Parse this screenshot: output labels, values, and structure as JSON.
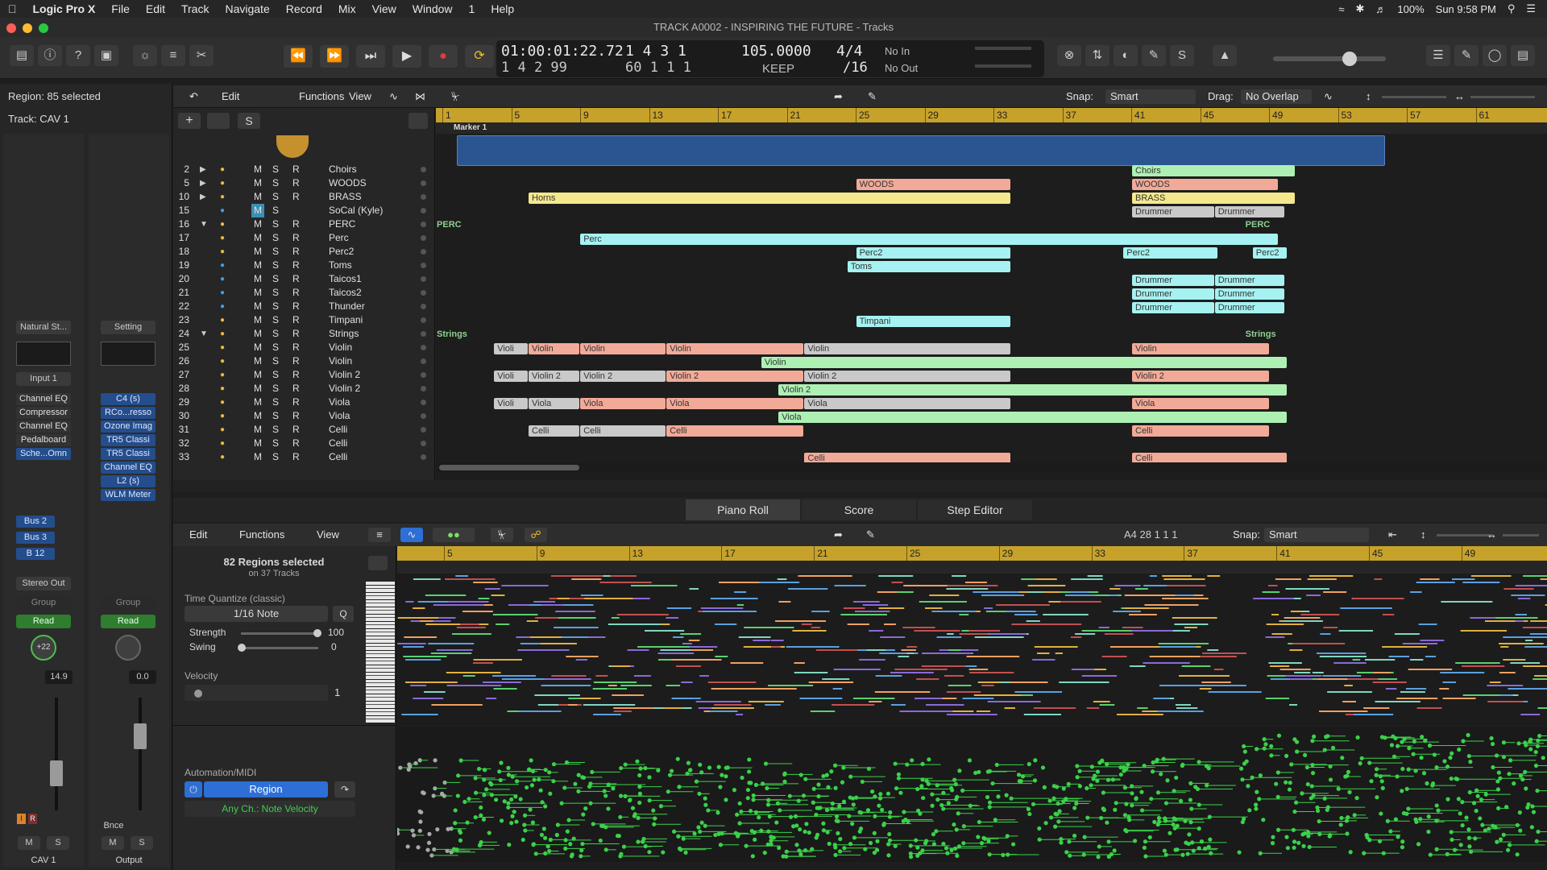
{
  "menubar": {
    "app": "Logic Pro X",
    "items": [
      "File",
      "Edit",
      "Track",
      "Navigate",
      "Record",
      "Mix",
      "View",
      "Window",
      "1",
      "Help"
    ],
    "battery": "100%",
    "clock": "Sun 9:58 PM"
  },
  "window": {
    "title": "TRACK A0002 - INSPIRING THE FUTURE - Tracks"
  },
  "lcd": {
    "time": "01:00:01:22.72",
    "time_sub": "1  4  2  99",
    "bars": "1  4  3     1",
    "bars_sub": "60  1  1     1",
    "tempo": "105.0000",
    "tempo_sub": "KEEP",
    "sig": "4/4",
    "sig_sub": "/16",
    "in": "No In",
    "out": "No Out"
  },
  "inspector": {
    "region": "Region: 85 selected",
    "track": "Track: CAV 1",
    "preset": "Natural St...",
    "setting": "Setting",
    "input": "Input 1",
    "plugins_left": [
      "Channel EQ",
      "Compressor",
      "Channel EQ",
      "Pedalboard",
      "Sche...Omn"
    ],
    "plugins_right": [
      "C4 (s)",
      "RCo...resso",
      "Ozone Imag",
      "TR5 Classi",
      "TR5 Classi",
      "Channel EQ",
      "L2 (s)",
      "WLM Meter"
    ],
    "sends": [
      "Bus 2",
      "Bus 3",
      "B 12"
    ],
    "stereo_out": "Stereo Out",
    "group": "Group",
    "read": "Read",
    "pan_left": "+22",
    "vol_left": "14.9",
    "vol_right": "0.0",
    "bnce": "Bnce",
    "m": "M",
    "s": "S",
    "name_left": "CAV 1",
    "name_right": "Output"
  },
  "tracks_toolbar": {
    "edit": "Edit",
    "functions": "Functions",
    "view": "View",
    "snap_label": "Snap:",
    "snap": "Smart",
    "drag_label": "Drag:",
    "drag": "No Overlap"
  },
  "ruler": [
    "1",
    "5",
    "9",
    "13",
    "17",
    "21",
    "25",
    "29",
    "33",
    "37",
    "41",
    "45",
    "49",
    "53",
    "57",
    "61"
  ],
  "marker": "Marker 1",
  "track_rows": [
    {
      "num": "2",
      "name": "Choirs"
    },
    {
      "num": "5",
      "name": "WOODS"
    },
    {
      "num": "10",
      "name": "BRASS"
    },
    {
      "num": "15",
      "name": "SoCal (Kyle)"
    },
    {
      "num": "16",
      "name": "PERC"
    },
    {
      "num": "17",
      "name": "Perc"
    },
    {
      "num": "18",
      "name": "Perc2"
    },
    {
      "num": "19",
      "name": "Toms"
    },
    {
      "num": "20",
      "name": "Taicos1"
    },
    {
      "num": "21",
      "name": "Taicos2"
    },
    {
      "num": "22",
      "name": "Thunder"
    },
    {
      "num": "23",
      "name": "Timpani"
    },
    {
      "num": "24",
      "name": "Strings"
    },
    {
      "num": "25",
      "name": "Violin"
    },
    {
      "num": "26",
      "name": "Violin"
    },
    {
      "num": "27",
      "name": "Violin 2"
    },
    {
      "num": "28",
      "name": "Violin 2"
    },
    {
      "num": "29",
      "name": "Viola"
    },
    {
      "num": "30",
      "name": "Viola"
    },
    {
      "num": "31",
      "name": "Celli"
    },
    {
      "num": "32",
      "name": "Celli"
    },
    {
      "num": "33",
      "name": "Celli"
    }
  ],
  "track_ms": {
    "m": "M",
    "s": "S",
    "r": "R"
  },
  "region_labels": {
    "choirs": "Choirs",
    "woods": "WOODS",
    "brass": "BRASS",
    "horns": "Horns",
    "drummer": "Drummer",
    "perc_folder": "PERC",
    "perc": "Perc",
    "perc2": "Perc2",
    "toms": "Toms",
    "timpani": "Timpani",
    "strings": "Strings",
    "violin": "Violin",
    "violi": "Violi",
    "violin2": "Violin 2",
    "viola": "Viola",
    "celli": "Celli"
  },
  "editor_tabs": [
    "Piano Roll",
    "Score",
    "Step Editor"
  ],
  "pr_toolbar": {
    "edit": "Edit",
    "functions": "Functions",
    "view": "View",
    "position": "A4   28 1 1 1",
    "snap_label": "Snap:",
    "snap": "Smart"
  },
  "pr_inspector": {
    "regions_selected": "82 Regions selected",
    "on_tracks": "on 37 Tracks",
    "tq_label": "Time Quantize (classic)",
    "tq_value": "1/16 Note",
    "q": "Q",
    "strength_label": "Strength",
    "strength": "100",
    "swing_label": "Swing",
    "swing": "0",
    "velocity_label": "Velocity",
    "velocity": "1",
    "automation": "Automation/MIDI",
    "region": "Region",
    "channel": "Any Ch.: Note Velocity"
  },
  "pr_ruler": [
    "5",
    "9",
    "13",
    "17",
    "21",
    "25",
    "29",
    "33",
    "37",
    "41",
    "45",
    "49"
  ],
  "colors": {
    "ruler": "#c7a22b",
    "accent": "#2d6fd6",
    "velocity": "#3bd14a"
  }
}
